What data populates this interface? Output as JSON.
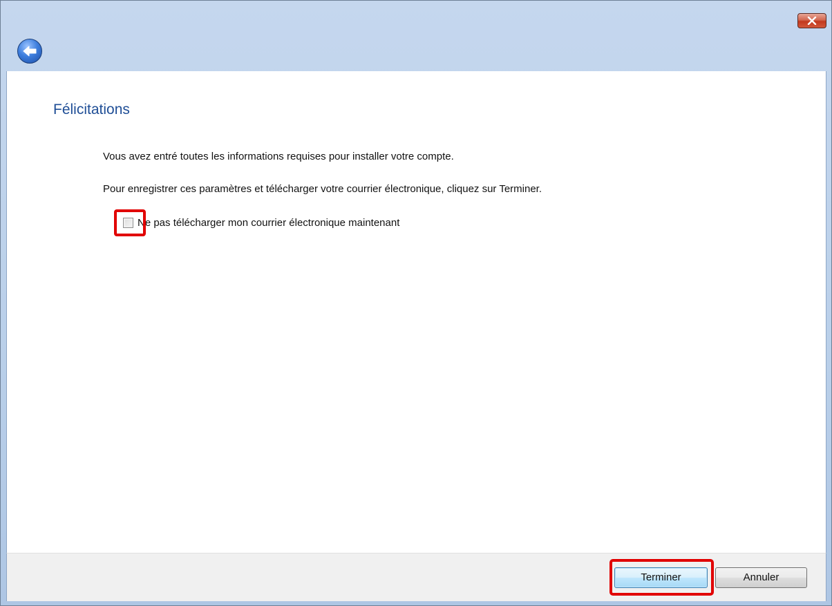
{
  "window": {
    "close_icon": "close-icon",
    "back_icon": "back-arrow-icon"
  },
  "content": {
    "heading": "Félicitations",
    "paragraph1": "Vous avez entré toutes les informations requises pour installer votre compte.",
    "paragraph2": "Pour enregistrer ces paramètres et télécharger votre courrier électronique, cliquez sur Terminer.",
    "checkbox": {
      "label": "Ne pas télécharger mon courrier électronique maintenant",
      "checked": false
    }
  },
  "footer": {
    "finish_label": "Terminer",
    "cancel_label": "Annuler"
  },
  "colors": {
    "heading": "#1f4e96",
    "highlight": "#e10000",
    "titlebar": "#b9cfe9"
  }
}
